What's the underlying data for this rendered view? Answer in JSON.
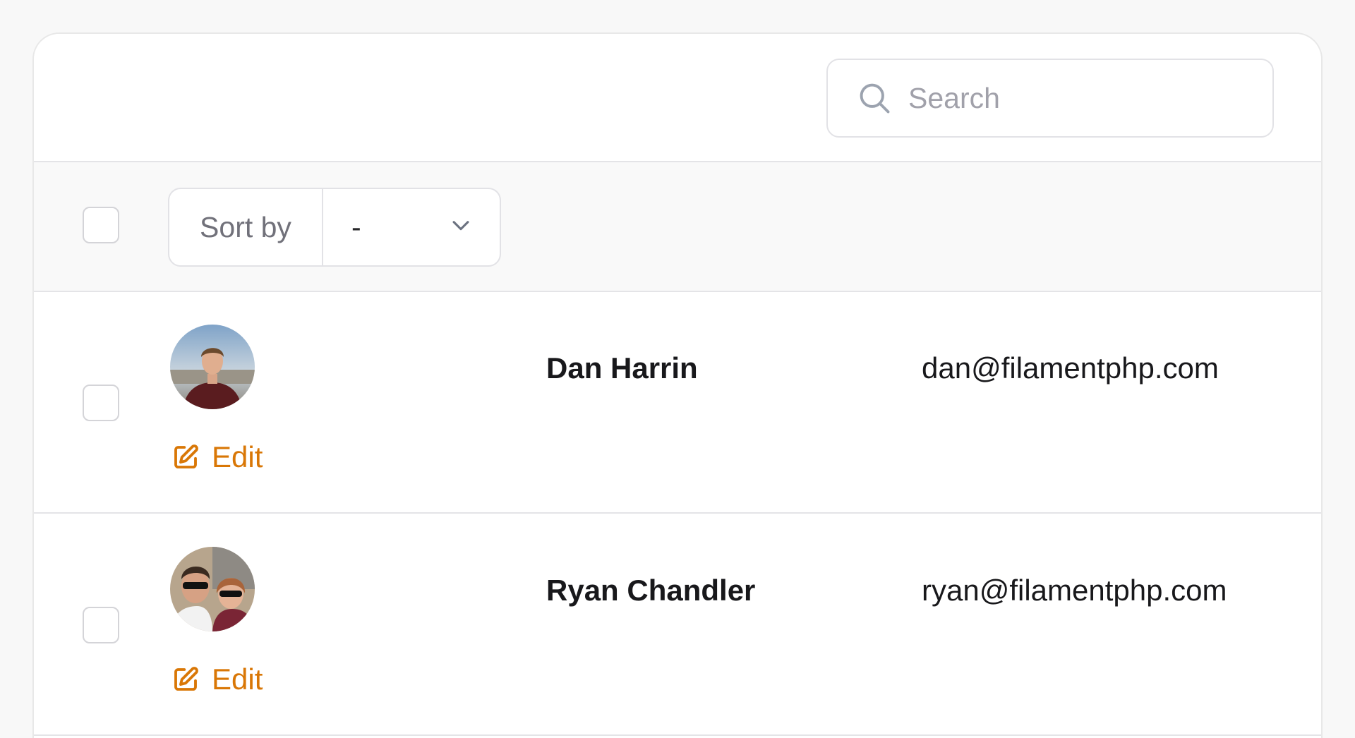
{
  "search": {
    "placeholder": "Search",
    "icon": "search-icon"
  },
  "toolbar": {
    "sort_label": "Sort by",
    "sort_value": "-",
    "sort_icon": "chevron-down-icon"
  },
  "rows": [
    {
      "name": "Dan Harrin",
      "email": "dan@filamentphp.com",
      "edit_label": "Edit"
    },
    {
      "name": "Ryan Chandler",
      "email": "ryan@filamentphp.com",
      "edit_label": "Edit"
    }
  ],
  "colors": {
    "accent": "#d97706",
    "border": "#e4e4e7",
    "background": "#f8f8f8"
  }
}
